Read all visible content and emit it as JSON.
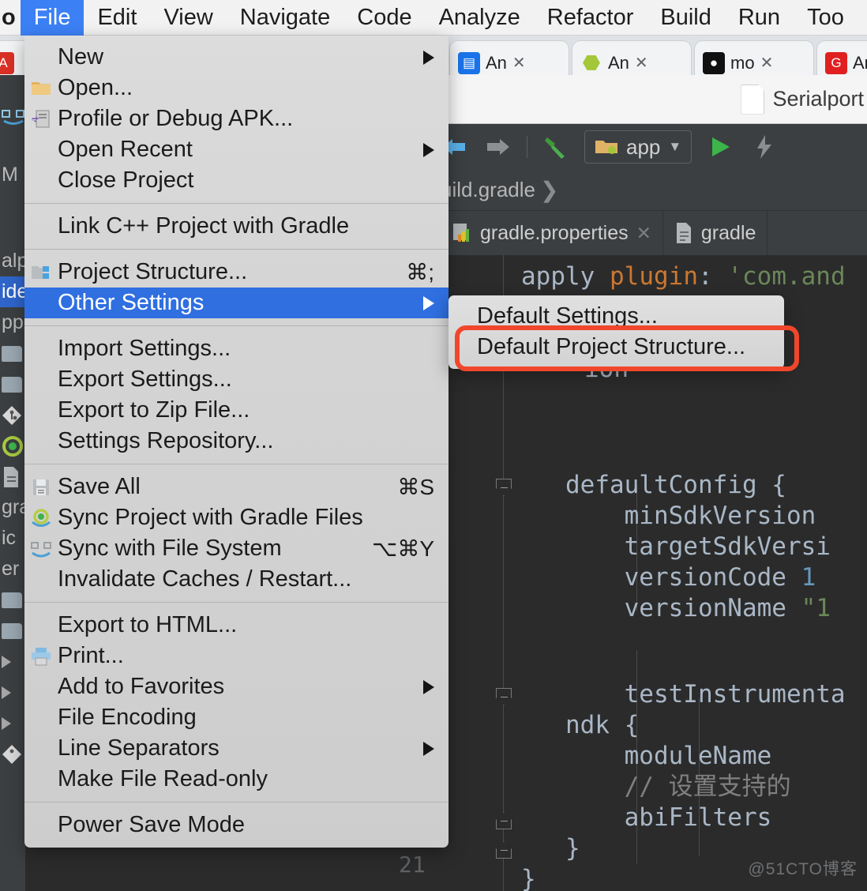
{
  "app": {
    "window_title": "Serialport",
    "watermark": "@51CTO博客"
  },
  "menubar": {
    "prefix_fragment": "o",
    "items": [
      {
        "label": "File",
        "active": true
      },
      {
        "label": "Edit",
        "active": false
      },
      {
        "label": "View",
        "active": false
      },
      {
        "label": "Navigate",
        "active": false
      },
      {
        "label": "Code",
        "active": false
      },
      {
        "label": "Analyze",
        "active": false
      },
      {
        "label": "Refactor",
        "active": false
      },
      {
        "label": "Build",
        "active": false
      },
      {
        "label": "Run",
        "active": false
      },
      {
        "label": "Too",
        "active": false
      }
    ]
  },
  "file_menu": {
    "groups": [
      {
        "items": [
          {
            "label": "New",
            "icon": "",
            "accel": "",
            "submenu": true,
            "highlight": false
          },
          {
            "label": "Open...",
            "icon": "folder-icon",
            "accel": "",
            "submenu": false,
            "highlight": false
          },
          {
            "label": "Profile or Debug APK...",
            "icon": "apk-icon",
            "accel": "",
            "submenu": false,
            "highlight": false
          },
          {
            "label": "Open Recent",
            "icon": "",
            "accel": "",
            "submenu": true,
            "highlight": false
          },
          {
            "label": "Close Project",
            "icon": "",
            "accel": "",
            "submenu": false,
            "highlight": false
          }
        ]
      },
      {
        "items": [
          {
            "label": "Link C++ Project with Gradle",
            "icon": "",
            "accel": "",
            "submenu": false,
            "highlight": false
          }
        ]
      },
      {
        "items": [
          {
            "label": "Project Structure...",
            "icon": "project-structure-icon",
            "accel": "⌘;",
            "submenu": false,
            "highlight": false
          },
          {
            "label": "Other Settings",
            "icon": "",
            "accel": "",
            "submenu": true,
            "highlight": true
          }
        ]
      },
      {
        "items": [
          {
            "label": "Import Settings...",
            "icon": "",
            "accel": "",
            "submenu": false,
            "highlight": false
          },
          {
            "label": "Export Settings...",
            "icon": "",
            "accel": "",
            "submenu": false,
            "highlight": false
          },
          {
            "label": "Export to Zip File...",
            "icon": "",
            "accel": "",
            "submenu": false,
            "highlight": false
          },
          {
            "label": "Settings Repository...",
            "icon": "",
            "accel": "",
            "submenu": false,
            "highlight": false
          }
        ]
      },
      {
        "items": [
          {
            "label": "Save All",
            "icon": "save-icon",
            "accel": "⌘S",
            "submenu": false,
            "highlight": false
          },
          {
            "label": "Sync Project with Gradle Files",
            "icon": "gradle-sync-icon",
            "accel": "",
            "submenu": false,
            "highlight": false
          },
          {
            "label": "Sync with File System",
            "icon": "fs-sync-icon",
            "accel": "⌥⌘Y",
            "submenu": false,
            "highlight": false
          },
          {
            "label": "Invalidate Caches / Restart...",
            "icon": "",
            "accel": "",
            "submenu": false,
            "highlight": false
          }
        ]
      },
      {
        "items": [
          {
            "label": "Export to HTML...",
            "icon": "",
            "accel": "",
            "submenu": false,
            "highlight": false
          },
          {
            "label": "Print...",
            "icon": "print-icon",
            "accel": "",
            "submenu": false,
            "highlight": false
          },
          {
            "label": "Add to Favorites",
            "icon": "",
            "accel": "",
            "submenu": true,
            "highlight": false
          },
          {
            "label": "File Encoding",
            "icon": "",
            "accel": "",
            "submenu": false,
            "highlight": false
          },
          {
            "label": "Line Separators",
            "icon": "",
            "accel": "",
            "submenu": true,
            "highlight": false
          },
          {
            "label": "Make File Read-only",
            "icon": "",
            "accel": "",
            "submenu": false,
            "highlight": false
          }
        ]
      },
      {
        "items": [
          {
            "label": "Power Save Mode",
            "icon": "",
            "accel": "",
            "submenu": false,
            "highlight": false
          }
        ]
      }
    ]
  },
  "other_settings_submenu": {
    "items": [
      {
        "label": "Default Settings...",
        "annotated": false
      },
      {
        "label": "Default Project Structure...",
        "annotated": true
      }
    ],
    "annotation_color": "#f0472c"
  },
  "browser_tabs": [
    {
      "label": "An",
      "favicon": "blue-square-icon",
      "color": "#1a73e8",
      "glyph": "▤",
      "active": false
    },
    {
      "label": "An",
      "favicon": "android-icon",
      "color": "#a4c639",
      "glyph": "🤖",
      "active": false
    },
    {
      "label": "mo",
      "favicon": "black-circle-icon",
      "color": "#111111",
      "glyph": "●",
      "active": false
    },
    {
      "label": "An",
      "favicon": "red-g-icon",
      "color": "#e02020",
      "glyph": "G",
      "active": false
    }
  ],
  "ide_toolbar": {
    "back_label": "back-arrow",
    "forward_label": "forward-arrow",
    "build_label": "make-project",
    "module": "app",
    "run_label": "run",
    "debug_label": "instant-run"
  },
  "breadcrumb": {
    "parts": [
      "uild.gradle"
    ]
  },
  "editor_tabs": [
    {
      "label": "",
      "icon": "",
      "closable": true
    },
    {
      "label": "gradle.properties",
      "icon": "gradle-props-icon",
      "closable": true
    },
    {
      "label": "gradle",
      "icon": "file-icon",
      "closable": false
    }
  ],
  "project_panel_rows": [
    {
      "label": "",
      "type": "icon-fs-sync",
      "selected": false
    },
    {
      "label": "",
      "type": "text",
      "selected": false
    },
    {
      "label": "",
      "type": "text",
      "selected": false
    },
    {
      "label": "",
      "type": "text",
      "selected": false
    },
    {
      "label": "",
      "type": "text",
      "selected": true
    },
    {
      "label": "",
      "type": "text",
      "selected": false
    }
  ],
  "code": {
    "line_number": "21",
    "lines": [
      "apply plugin: 'com.and",
      "",
      "",
      "",
      "",
      "",
      "    defaultConfig {",
      "        minSdkVersion ",
      "        targetSdkVersi",
      "        versionCode 1",
      "        versionName \"1",
      "",
      "        testInstrumenta",
      "        ndk {",
      "            moduleName ",
      "            // 设置支持的",
      "            abiFilters ",
      "        }",
      "    }"
    ],
    "visible_text": [
      "apply plugin: 'com.and",
      "ion",
      "defaultConfig {",
      "minSdkVersion",
      "targetSdkVersi",
      "versionCode 1",
      "versionName \"1",
      "testInstrumenta",
      "ndk {",
      "moduleName",
      "// 设置支持的",
      "abiFilters",
      "}",
      "}"
    ]
  }
}
